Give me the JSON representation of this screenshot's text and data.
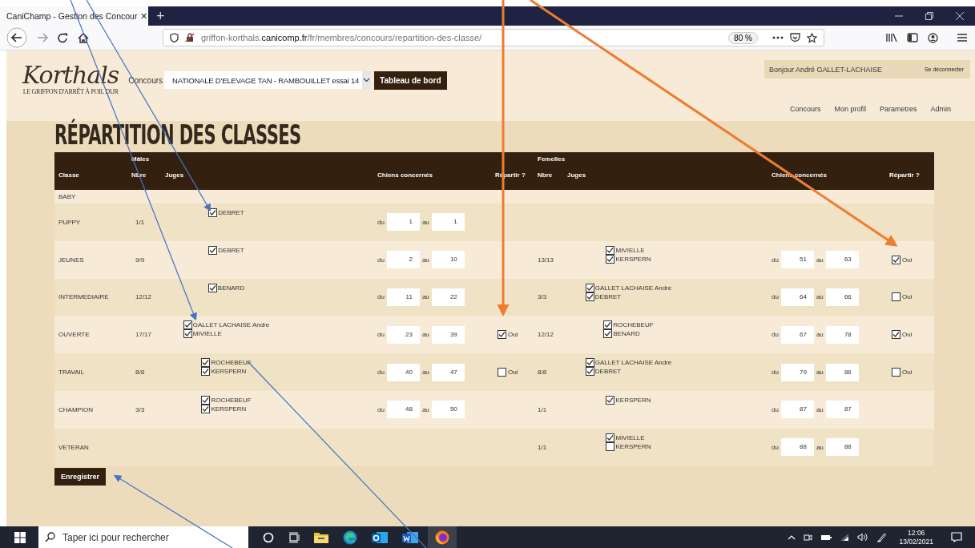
{
  "browser": {
    "tab": {
      "title": "CaniChamp - Gestion des Concour",
      "close": "×"
    },
    "new_tab": "+",
    "url": "griffon-korthals.**canicomp.fr**/fr/membres/concours/repartition-des-classe/",
    "zoom": "80 %"
  },
  "header": {
    "logo": {
      "name": "Korthals",
      "tagline": "LE GRIFFON D'ARRÊT À POIL DUR"
    },
    "concours_label": "Concours",
    "concours_value": "NATIONALE D'ELEVAGE TAN - RAMBOUILLET essai 14",
    "dashboard_button": "Tableau de bord",
    "greeting": "Bonjour André GALLET-LACHAISE",
    "logout": "Se déconnecter",
    "nav": [
      "Concours",
      "Mon profil",
      "Parametres",
      "Admin"
    ]
  },
  "title": "RÉPARTITION DES CLASSES",
  "table": {
    "group_males": "Mâles",
    "group_females": "Femelles",
    "columns": [
      "Classe",
      "Nbre",
      "Juges",
      "Chiens concernés",
      "Répartir ?",
      "Nbre",
      "Juges",
      "Chiens concernés",
      "Répartir ?"
    ],
    "rows": [
      {
        "classe": "BABY"
      },
      {
        "classe": "PUPPY",
        "males": {
          "nbre": "1/1",
          "juges": [
            {
              "name": "DEBRET",
              "checked": true
            }
          ],
          "du_label": "du",
          "du": "1",
          "au_label": "au",
          "au": "1"
        }
      },
      {
        "classe": "JEUNES",
        "males": {
          "nbre": "9/9",
          "juges": [
            {
              "name": "DEBRET",
              "checked": true
            }
          ],
          "du_label": "du",
          "du": "2",
          "au_label": "au",
          "au": "10"
        },
        "females": {
          "nbre": "13/13",
          "juges": [
            {
              "name": "MIVIELLE",
              "checked": true
            },
            {
              "name": "KERSPERN",
              "checked": true
            }
          ],
          "du_label": "du",
          "du": "51",
          "au_label": "au",
          "au": "63",
          "repartir": {
            "label": "Oui",
            "checked": true
          }
        }
      },
      {
        "classe": "INTERMEDIAIRE",
        "males": {
          "nbre": "12/12",
          "juges": [
            {
              "name": "BENARD",
              "checked": true
            }
          ],
          "du_label": "du",
          "du": "11",
          "au_label": "au",
          "au": "22"
        },
        "females": {
          "nbre": "3/3",
          "juges": [
            {
              "name": "GALLET LACHAISE Andre",
              "checked": true
            },
            {
              "name": "DEBRET",
              "checked": true
            }
          ],
          "du_label": "du",
          "du": "64",
          "au_label": "au",
          "au": "66",
          "repartir": {
            "label": "Oui",
            "checked": false
          }
        }
      },
      {
        "classe": "OUVERTE",
        "males": {
          "nbre": "17/17",
          "juges": [
            {
              "name": "GALLET LACHAISE Andre",
              "checked": true
            },
            {
              "name": "MIVIELLE",
              "checked": true
            }
          ],
          "du_label": "du",
          "du": "23",
          "au_label": "au",
          "au": "39",
          "repartir": {
            "label": "Oui",
            "checked": true
          }
        },
        "females": {
          "nbre": "12/12",
          "juges": [
            {
              "name": "ROCHEBEUF",
              "checked": true
            },
            {
              "name": "BENARD",
              "checked": true
            }
          ],
          "du_label": "du",
          "du": "67",
          "au_label": "au",
          "au": "78",
          "repartir": {
            "label": "Oui",
            "checked": true
          }
        }
      },
      {
        "classe": "TRAVAIL",
        "males": {
          "nbre": "8/8",
          "juges": [
            {
              "name": "ROCHEBEUF",
              "checked": true
            },
            {
              "name": "KERSPERN",
              "checked": true
            }
          ],
          "du_label": "du",
          "du": "40",
          "au_label": "au",
          "au": "47",
          "repartir": {
            "label": "Oui",
            "checked": false
          }
        },
        "females": {
          "nbre": "8/8",
          "juges": [
            {
              "name": "GALLET LACHAISE Andre",
              "checked": true
            },
            {
              "name": "DEBRET",
              "checked": true
            }
          ],
          "du_label": "du",
          "du": "79",
          "au_label": "au",
          "au": "86",
          "repartir": {
            "label": "Oui",
            "checked": false
          }
        }
      },
      {
        "classe": "CHAMPION",
        "males": {
          "nbre": "3/3",
          "juges": [
            {
              "name": "ROCHEBEUF",
              "checked": true
            },
            {
              "name": "KERSPERN",
              "checked": true
            }
          ],
          "du_label": "du",
          "du": "48",
          "au_label": "au",
          "au": "50"
        },
        "females": {
          "nbre": "1/1",
          "juges": [
            {
              "name": "KERSPERN",
              "checked": true
            }
          ],
          "du_label": "du",
          "du": "87",
          "au_label": "au",
          "au": "87"
        }
      },
      {
        "classe": "VETERAN",
        "females": {
          "nbre": "1/1",
          "juges": [
            {
              "name": "MIVIELLE",
              "checked": true
            },
            {
              "name": "KERSPERN",
              "checked": false
            }
          ],
          "du_label": "du",
          "du": "88",
          "au_label": "au",
          "au": "88"
        }
      }
    ]
  },
  "save_button": "Enregistrer",
  "taskbar": {
    "search_placeholder": "Taper ici pour rechercher",
    "time": "12:06",
    "date": "13/02/2021"
  }
}
